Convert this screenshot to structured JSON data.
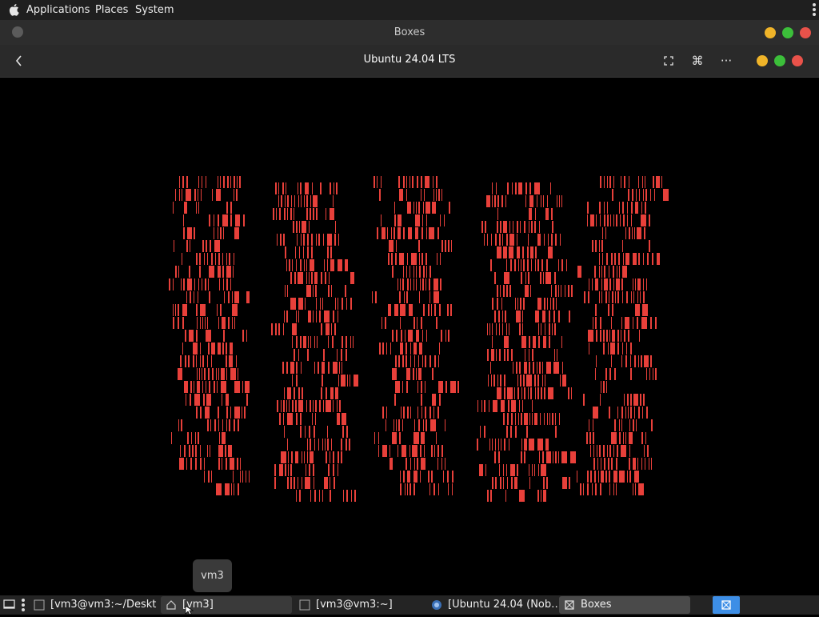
{
  "topbar": {
    "menus": [
      {
        "label": "Applications"
      },
      {
        "label": "Places"
      },
      {
        "label": "System"
      }
    ]
  },
  "host_window": {
    "title": "Boxes"
  },
  "boxes": {
    "vm_title": "Ubuntu 24.04 LTS",
    "toolbar_icons": [
      "back-icon",
      "fullscreen-icon",
      "keyboard-shortcut-icon",
      "more-icon"
    ]
  },
  "vm_screen": {
    "text_color": "#e8403a",
    "content": "red vertical-bar glyph garbage (corrupted framebuffer)"
  },
  "tooltip": {
    "text": "vm3"
  },
  "taskbar": {
    "items": [
      {
        "label": "[vm3@vm3:~/Deskt…",
        "icon": "terminal-icon"
      },
      {
        "label": "[vm3]",
        "icon": "home-folder-icon"
      },
      {
        "label": "[vm3@vm3:~]",
        "icon": "terminal-icon"
      },
      {
        "label": "[Ubuntu 24.04 (Nob…",
        "icon": "browser-icon"
      },
      {
        "label": "Boxes",
        "icon": "boxes-icon"
      }
    ]
  },
  "colors": {
    "accent": "#3d8ee6",
    "close": "#e9524a",
    "minimize": "#f0b429",
    "maximize": "#3cbf3a"
  }
}
